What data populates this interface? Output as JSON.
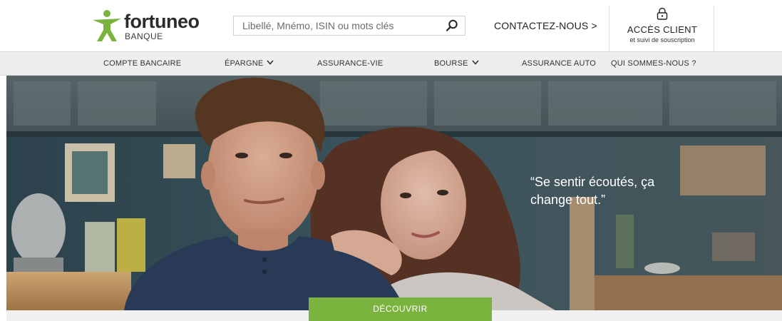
{
  "brand": {
    "name": "fortuneo",
    "subtitle": "BANQUE",
    "color_green": "#7ab33e",
    "logo_icon": "runner-logo-icon"
  },
  "search": {
    "placeholder": "Libellé, Mnémo, ISIN ou mots clés",
    "icon": "search-icon"
  },
  "header": {
    "contact_label": "CONTACTEZ-NOUS >",
    "client_title": "ACCÈS CLIENT",
    "client_subtitle": "et suivi de souscription",
    "client_icon": "lock-icon"
  },
  "nav": {
    "items": [
      {
        "label": "COMPTE BANCAIRE",
        "has_dropdown": false
      },
      {
        "label": "ÉPARGNE",
        "has_dropdown": true
      },
      {
        "label": "ASSURANCE-VIE",
        "has_dropdown": false
      },
      {
        "label": "BOURSE",
        "has_dropdown": true
      },
      {
        "label": "ASSURANCE AUTO",
        "has_dropdown": false
      },
      {
        "label": "QUI SOMMES-NOUS ?",
        "has_dropdown": false
      }
    ]
  },
  "hero": {
    "quote_line1": "“Se sentir écoutés, ça",
    "quote_line2": "change tout.”",
    "cta_label": "DÉCOUVRIR"
  }
}
